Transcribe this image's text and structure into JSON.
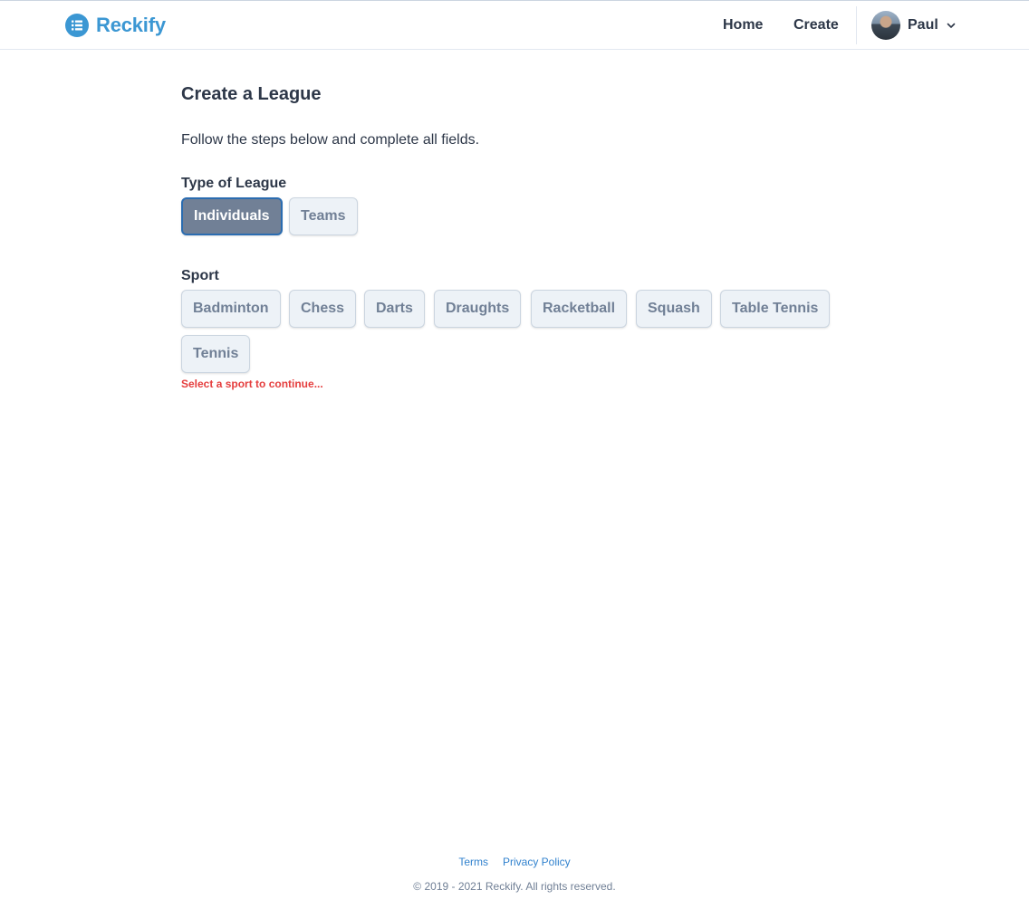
{
  "header": {
    "brand": "Reckify",
    "brand_color": "#3b97d3",
    "nav": {
      "home": "Home",
      "create": "Create"
    },
    "user": {
      "name": "Paul"
    }
  },
  "main": {
    "title": "Create a League",
    "intro": "Follow the steps below and complete all fields.",
    "league_type": {
      "label": "Type of League",
      "options": [
        "Individuals",
        "Teams"
      ],
      "selected": "Individuals"
    },
    "sport": {
      "label": "Sport",
      "options": [
        "Badminton",
        "Chess",
        "Darts",
        "Draughts",
        "Racketball",
        "Squash",
        "Table Tennis",
        "Tennis"
      ],
      "error": "Select a sport to continue..."
    }
  },
  "footer": {
    "links": [
      "Terms",
      "Privacy Policy"
    ],
    "copyright": "© 2019 - 2021 Reckify. All rights reserved."
  },
  "colors": {
    "selected_chip": "#718096",
    "selected_border": "#2b6cb0",
    "error": "#e53e3e",
    "link": "#3182ce"
  }
}
